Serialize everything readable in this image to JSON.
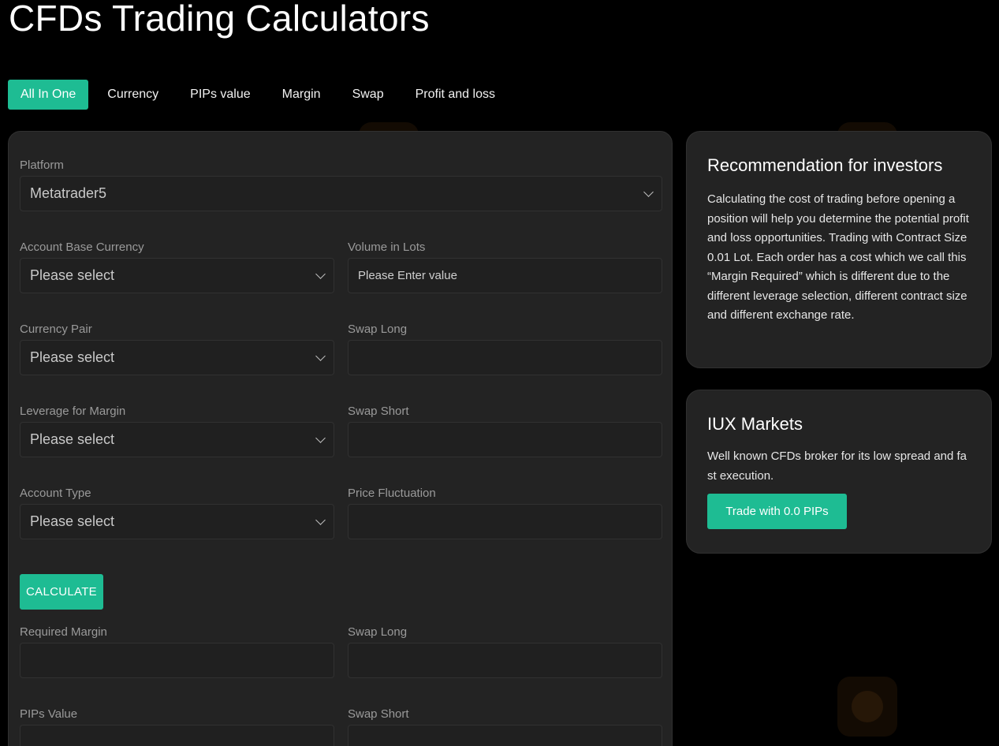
{
  "page_title": "CFDs Trading Calculators",
  "tabs": [
    {
      "label": "All In One",
      "active": true
    },
    {
      "label": "Currency",
      "active": false
    },
    {
      "label": "PIPs value",
      "active": false
    },
    {
      "label": "Margin",
      "active": false
    },
    {
      "label": "Swap",
      "active": false
    },
    {
      "label": "Profit and loss",
      "active": false
    }
  ],
  "form": {
    "platform": {
      "label": "Platform",
      "value": "Metatrader5"
    },
    "account_base_currency": {
      "label": "Account Base Currency",
      "value": "Please select"
    },
    "volume_in_lots": {
      "label": "Volume in Lots",
      "placeholder": "Please Enter value"
    },
    "currency_pair": {
      "label": "Currency Pair",
      "value": "Please select"
    },
    "swap_long": {
      "label": "Swap Long",
      "value": ""
    },
    "leverage_for_margin": {
      "label": "Leverage for Margin",
      "value": "Please select"
    },
    "swap_short": {
      "label": "Swap Short",
      "value": ""
    },
    "account_type": {
      "label": "Account Type",
      "value": "Please select"
    },
    "price_fluctuation": {
      "label": "Price Fluctuation",
      "value": ""
    },
    "calculate_label": "CALCULATE"
  },
  "results": {
    "required_margin": {
      "label": "Required Margin",
      "value": ""
    },
    "swap_long": {
      "label": "Swap Long",
      "value": ""
    },
    "pips_value": {
      "label": "PIPs Value",
      "value": ""
    },
    "swap_short": {
      "label": "Swap Short",
      "value": ""
    }
  },
  "recommendation": {
    "title": "Recommendation for investors",
    "text": "Calculating the cost of trading before opening a position will help you determine the potential profit and loss opportunities. Trading with Contract Size 0.01 Lot. Each order has a cost which we call this “Margin Required” which is different due to the different leverage selection, different contract size and different exchange rate."
  },
  "broker_card": {
    "title": "IUX Markets",
    "text": "Well known CFDs broker for its low spread and fast execution.",
    "button_label": "Trade with 0.0 PIPs"
  },
  "colors": {
    "accent": "#1ebc93",
    "background": "#000000",
    "panel": "#232323"
  }
}
